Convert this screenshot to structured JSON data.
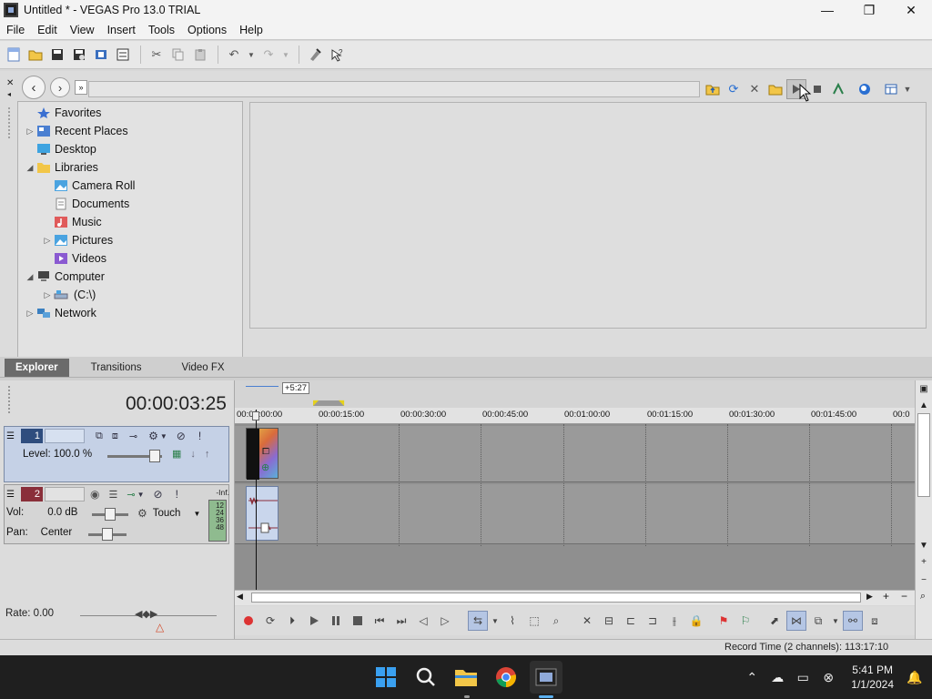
{
  "window": {
    "title": "Untitled * - VEGAS Pro 13.0 TRIAL",
    "minimize": "—",
    "maximize": "❐",
    "close": "✕"
  },
  "menu": [
    "File",
    "Edit",
    "View",
    "Insert",
    "Tools",
    "Options",
    "Help"
  ],
  "explorer": {
    "tree": [
      {
        "label": "Favorites",
        "icon": "star-icon",
        "color": "#f0c040"
      },
      {
        "label": "Recent Places",
        "icon": "recent-places-icon",
        "color": "#4a7fd1"
      },
      {
        "label": "Desktop",
        "icon": "desktop-icon",
        "color": "#3ea3e0"
      },
      {
        "label": "Libraries",
        "icon": "folder-icon",
        "color": "#f2c648"
      },
      {
        "label": "Camera Roll",
        "icon": "camera-roll-icon",
        "color": "#4aa3e0"
      },
      {
        "label": "Documents",
        "icon": "documents-icon",
        "color": "#8a8a8a"
      },
      {
        "label": "Music",
        "icon": "music-icon",
        "color": "#e05a5a"
      },
      {
        "label": "Pictures",
        "icon": "pictures-icon",
        "color": "#4aa3e0"
      },
      {
        "label": "Videos",
        "icon": "videos-icon",
        "color": "#8a5ad1"
      },
      {
        "label": "Computer",
        "icon": "computer-icon",
        "color": "#555555"
      },
      {
        "label": "(C:\\)",
        "icon": "drive-icon",
        "color": "#6a8fc0"
      },
      {
        "label": "Network",
        "icon": "network-icon",
        "color": "#3a7fc0"
      }
    ],
    "tabs": [
      "Explorer",
      "Transitions",
      "Video FX"
    ]
  },
  "timeline": {
    "time": "00:00:03:25",
    "offset": "+5:27",
    "ruler": [
      "00:00:00:00",
      "00:00:15:00",
      "00:00:30:00",
      "00:00:45:00",
      "00:01:00:00",
      "00:01:15:00",
      "00:01:30:00",
      "00:01:45:00",
      "00:0"
    ],
    "video_track": {
      "number": "1",
      "level_label": "Level: 100.0 %",
      "level": 1.0
    },
    "audio_track": {
      "number": "2",
      "vol_label": "Vol:",
      "vol_value": "0.0 dB",
      "pan_label": "Pan:",
      "pan_value": "Center",
      "mode": "Touch",
      "meter_top": "-Inf.",
      "meter_scale": [
        "12",
        "24",
        "36",
        "48"
      ]
    },
    "rate": "Rate: 0.00"
  },
  "status": {
    "record_time": "Record Time (2 channels): 113:17:10"
  },
  "taskbar": {
    "time": "5:41 PM",
    "date": "1/1/2024"
  },
  "colors": {
    "video_track": "#c5d1e6",
    "audio_track": "#d5d5d5",
    "track_num_video": "#2f4d7e",
    "track_num_audio": "#8a2f3a"
  }
}
